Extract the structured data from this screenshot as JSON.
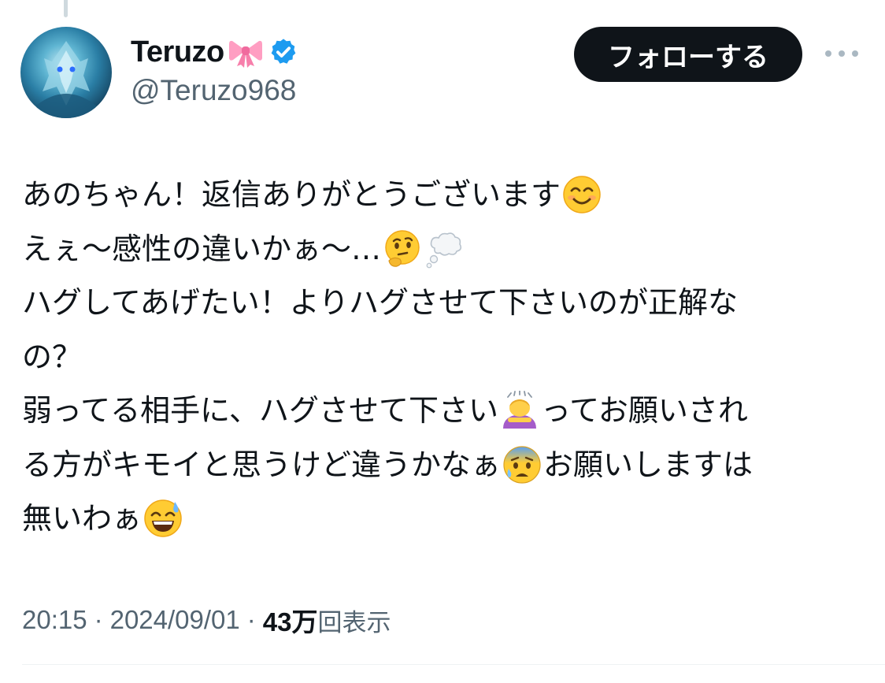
{
  "author": {
    "display_name": "Teruzo",
    "name_emoji": "ribbon-emoji",
    "verified": true,
    "handle": "@Teruzo968"
  },
  "actions": {
    "follow_label": "フォローする",
    "more_icon": "more-horizontal-icon"
  },
  "tweet": {
    "lines": [
      {
        "text": "あのちゃん！返信ありがとうございます",
        "emoji": "smiling-face-emoji"
      },
      {
        "text": "えぇ〜感性の違いかぁ〜…",
        "emoji": "thinking-face-emoji",
        "emoji2": "thought-balloon-emoji"
      },
      {
        "text": "ハグしてあげたい！よりハグさせて下さいのが正解な"
      },
      {
        "text": "の？"
      },
      {
        "text_before": "弱ってる相手に、ハグさせて下さい",
        "emoji": "person-bowing-emoji",
        "text_after": "ってお願いされ"
      },
      {
        "text_before": "る方がキモイと思うけど違うかなぁ",
        "emoji": "anxious-face-sweat-emoji",
        "text_after": "お願いしますは"
      },
      {
        "text": "無いわぁ",
        "emoji": "grinning-sweat-emoji"
      }
    ]
  },
  "meta": {
    "time": "20:15",
    "separator": "·",
    "date": "2024/09/01",
    "views_count": "43万",
    "views_label": "回表示"
  },
  "colors": {
    "text_primary": "#0f1419",
    "text_secondary": "#536471",
    "verified_blue": "#1d9bf0",
    "button_bg": "#0f1419"
  }
}
